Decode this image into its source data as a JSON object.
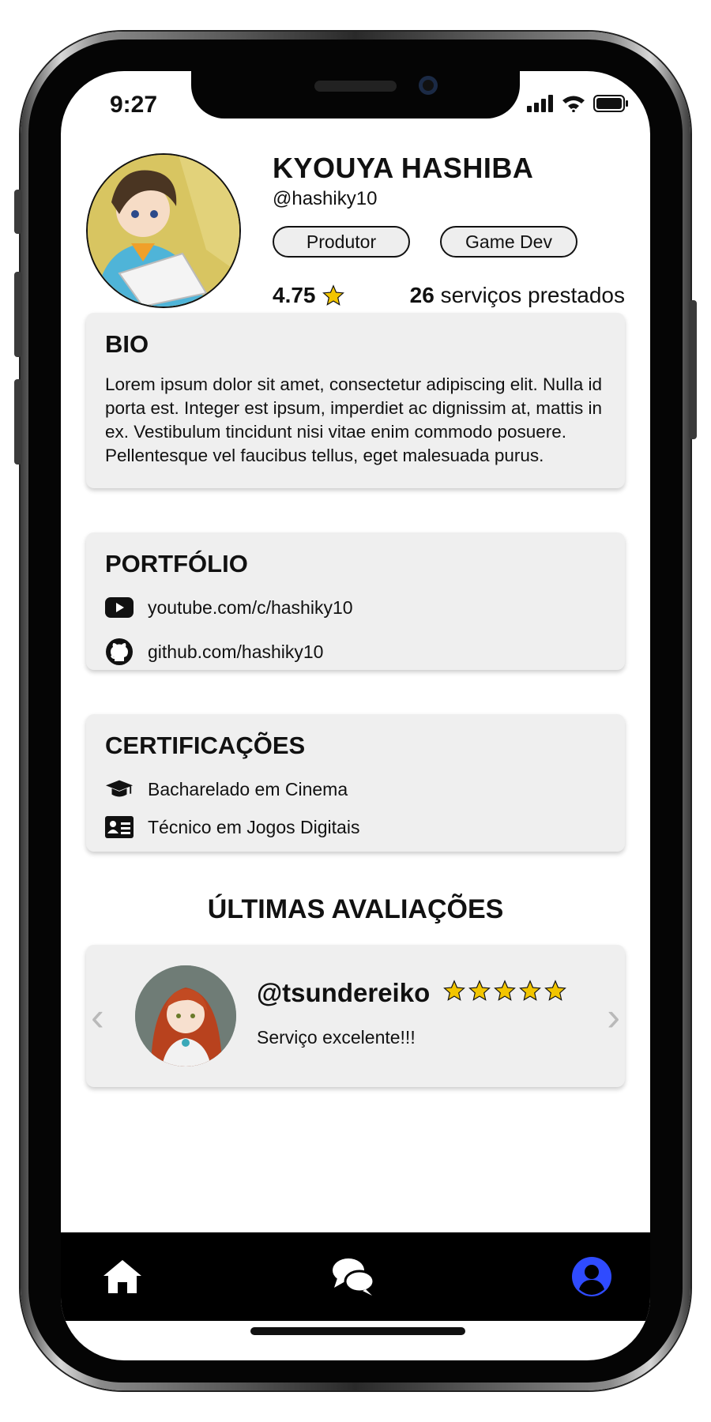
{
  "status_bar": {
    "time": "9:27"
  },
  "profile": {
    "name": "KYOUYA HASHIBA",
    "handle": "@hashiky10",
    "tags": [
      "Produtor",
      "Game Dev"
    ],
    "rating": "4.75",
    "services_count": "26",
    "services_label": "serviços prestados"
  },
  "bio": {
    "title": "BIO",
    "text": "Lorem ipsum dolor sit amet, consectetur adipiscing elit. Nulla id porta est. Integer est ipsum, imperdiet ac dignissim at, mattis in ex. Vestibulum tincidunt nisi vitae enim commodo posuere. Pellentesque vel faucibus tellus, eget malesuada purus."
  },
  "portfolio": {
    "title": "PORTFÓLIO",
    "items": [
      {
        "icon": "youtube-icon",
        "text": "youtube.com/c/hashiky10"
      },
      {
        "icon": "github-icon",
        "text": "github.com/hashiky10"
      }
    ]
  },
  "certifications": {
    "title": "CERTIFICAÇÕES",
    "items": [
      {
        "icon": "graduation-cap-icon",
        "text": "Bacharelado em Cinema"
      },
      {
        "icon": "id-card-icon",
        "text": "Técnico em Jogos Digitais"
      }
    ]
  },
  "reviews": {
    "title": "ÚLTIMAS AVALIAÇÕES",
    "current": {
      "user": "@tsundereiko",
      "stars": 5,
      "text": "Serviço excelente!!!"
    },
    "prev_symbol": "‹",
    "next_symbol": "›"
  },
  "navbar": {
    "items": [
      {
        "icon": "home-icon",
        "active": false
      },
      {
        "icon": "chat-icon",
        "active": false
      },
      {
        "icon": "profile-icon",
        "active": true
      }
    ],
    "active_color": "#2f4bff"
  },
  "colors": {
    "star": "#f2c500",
    "card_bg": "#efefef"
  }
}
